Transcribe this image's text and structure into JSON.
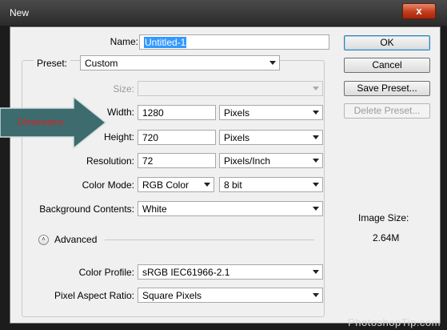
{
  "window": {
    "title": "New",
    "close_glyph": "x"
  },
  "form": {
    "name_label": "Name:",
    "name_value": "Untitled-1",
    "preset_label": "Preset:",
    "preset_value": "Custom",
    "size_label": "Size:",
    "size_value": "",
    "width_label": "Width:",
    "width_value": "1280",
    "width_unit": "Pixels",
    "height_label": "Height:",
    "height_value": "720",
    "height_unit": "Pixels",
    "resolution_label": "Resolution:",
    "resolution_value": "72",
    "resolution_unit": "Pixels/Inch",
    "color_mode_label": "Color Mode:",
    "color_mode_value": "RGB Color",
    "bit_depth_value": "8 bit",
    "background_label": "Background Contents:",
    "background_value": "White",
    "advanced_label": "Advanced",
    "color_profile_label": "Color Profile:",
    "color_profile_value": "sRGB IEC61966-2.1",
    "pixel_aspect_label": "Pixel Aspect Ratio:",
    "pixel_aspect_value": "Square Pixels"
  },
  "buttons": {
    "ok": "OK",
    "cancel": "Cancel",
    "save_preset": "Save Preset...",
    "delete_preset": "Delete Preset..."
  },
  "image_size": {
    "label": "Image Size:",
    "value": "2.64M"
  },
  "annotation": {
    "label": "Dimensions",
    "color": "#e11f1f",
    "arrow_color": "#3d6b6e"
  },
  "watermark": "PhotoshopTip.com",
  "colors": {
    "highlight": "#3399ff",
    "dialog_bg": "#f0f0f0",
    "titlebar": "#333333"
  }
}
